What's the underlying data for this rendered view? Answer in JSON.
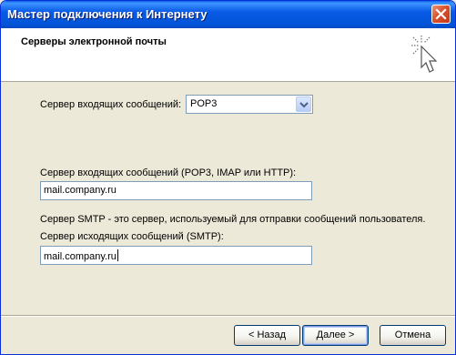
{
  "window": {
    "title": "Мастер подключения к Интернету"
  },
  "header": {
    "heading": "Серверы электронной почты",
    "icon": "wizard-cursor-icon"
  },
  "form": {
    "incoming_type_label": "Сервер входящих сообщений:",
    "incoming_type_value": "POP3",
    "incoming_server_label": "Сервер входящих сообщений (POP3, IMAP или HTTP):",
    "incoming_server_value": "mail.company.ru",
    "smtp_description": "Сервер SMTP - это сервер, используемый для отправки сообщений  пользователя.",
    "outgoing_server_label": "Сервер исходящих сообщений (SMTP):",
    "outgoing_server_value": "mail.company.ru"
  },
  "buttons": {
    "back": "< Назад",
    "next": "Далее >",
    "cancel": "Отмена"
  }
}
